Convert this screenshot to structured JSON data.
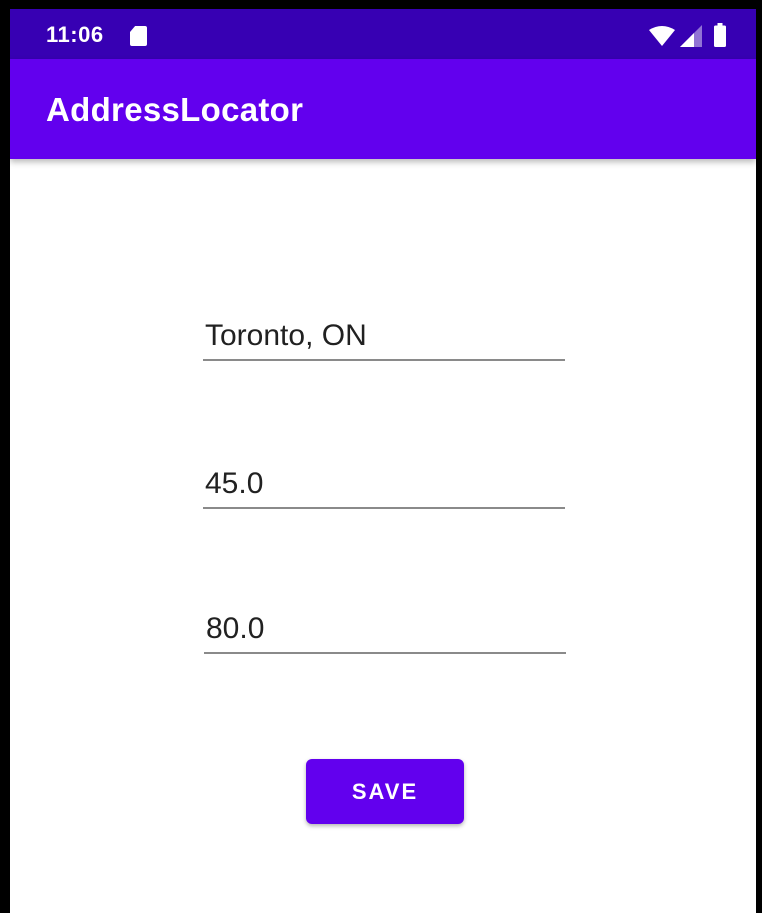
{
  "status_bar": {
    "time": "11:06",
    "icons": [
      "sd-card-icon",
      "wifi-icon",
      "signal-icon",
      "battery-icon"
    ]
  },
  "app_bar": {
    "title": "AddressLocator"
  },
  "form": {
    "address_value": "Toronto, ON",
    "latitude_value": "45.0",
    "longitude_value": "80.0",
    "save_label": "SAVE"
  },
  "colors": {
    "status_bar": "#3700b3",
    "primary": "#6200ee",
    "background": "#ffffff",
    "text": "#212121",
    "underline": "#8a8a8a"
  }
}
